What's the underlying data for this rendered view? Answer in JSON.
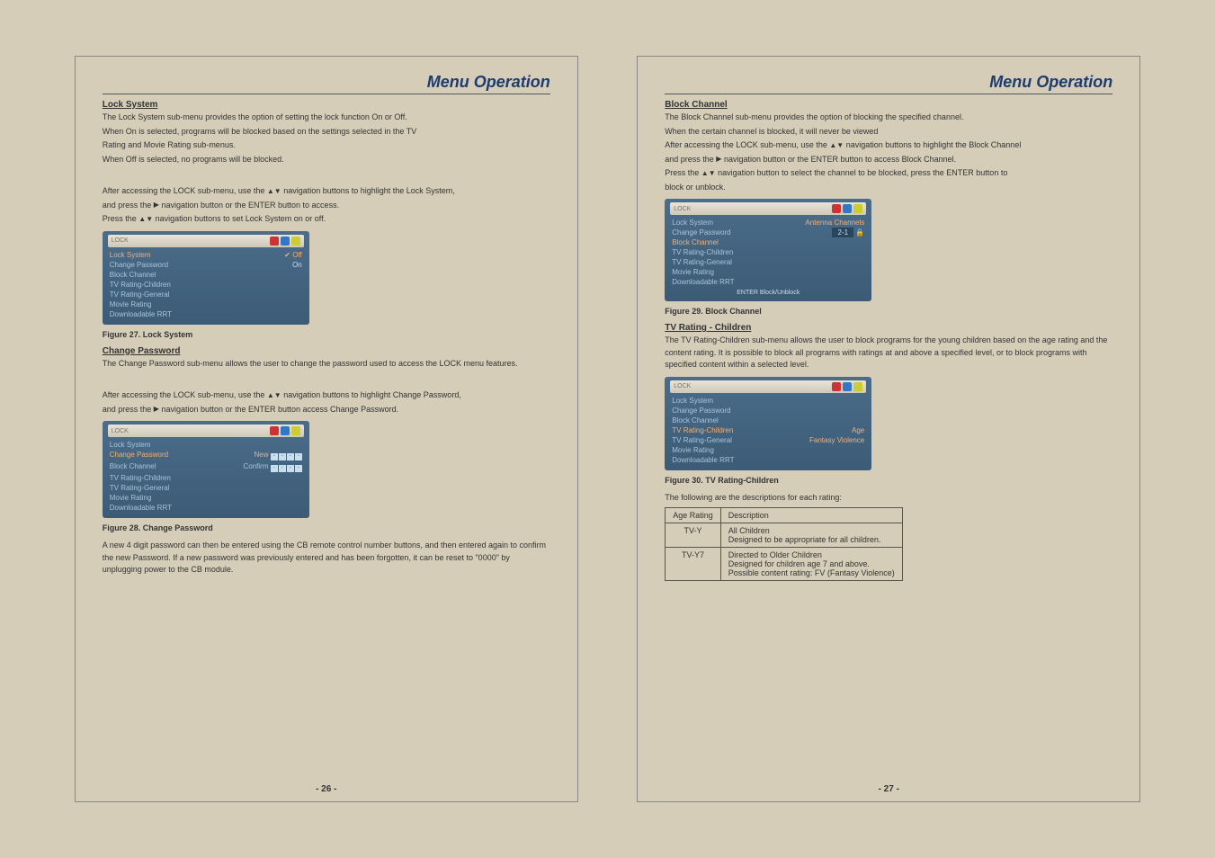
{
  "header": {
    "title": "Menu Operation"
  },
  "page_left": {
    "lock_system": {
      "title": "Lock System",
      "p1": "The Lock System sub-menu provides the option of setting the lock function On or Off.",
      "p2": "When On is selected, programs will be blocked based on the settings selected in the TV",
      "p3": "Rating and Movie Rating sub-menus.",
      "p4": "When Off is selected, no programs will be blocked.",
      "p5a": "After accessing the LOCK sub-menu, use the ",
      "p5b": "  navigation buttons to highlight the Lock System,",
      "p6a": "and press the  ",
      "p6b": "  navigation button or the ENTER button to access.",
      "p7a": "Press the ",
      "p7b": " navigation buttons to set Lock System on or off."
    },
    "fig27": "Figure 27. Lock System",
    "change_password": {
      "title": "Change Password",
      "p1": "The Change Password sub-menu allows the user to change the password used to access the LOCK menu features.",
      "p2a": "After accessing the LOCK sub-menu, use the ",
      "p2b": "    navigation buttons to highlight Change Password,",
      "p3a": "and press the  ",
      "p3b": "  navigation button or the ENTER  button access Change Password."
    },
    "fig28": "Figure 28. Change Password",
    "footnote": "A new 4 digit password can then be entered using the CB remote control number buttons, and then entered again to confirm the new Password. If a new password was previously entered and has been forgotten, it can be reset to \"0000\" by unplugging power to the CB module.",
    "page_num": "- 26 -",
    "osd1": {
      "header_left": "LOCK",
      "items": [
        {
          "label": "Lock System",
          "val": "✔ Off",
          "sel": true
        },
        {
          "label": "Change Password",
          "val": "On"
        },
        {
          "label": "Block Channel"
        },
        {
          "label": "TV Rating-Children"
        },
        {
          "label": "TV Rating-General"
        },
        {
          "label": "Movie Rating"
        },
        {
          "label": "Downloadable RRT"
        }
      ]
    },
    "osd2": {
      "header_left": "LOCK",
      "items": [
        {
          "label": "Lock System"
        },
        {
          "label": "Change Password",
          "sel": true,
          "fields": [
            {
              "k": "New"
            },
            {
              "k": "Confirm"
            }
          ]
        },
        {
          "label": "Block Channel"
        },
        {
          "label": "TV Rating-Children"
        },
        {
          "label": "TV Rating-General"
        },
        {
          "label": "Movie Rating"
        },
        {
          "label": "Downloadable RRT"
        }
      ]
    }
  },
  "page_right": {
    "block_channel": {
      "title": "Block Channel",
      "p1": "The Block Channel sub-menu provides the option of blocking the specified channel.",
      "p2": "When the certain channel is blocked, it will never be viewed",
      "p3a": "After accessing the LOCK sub-menu, use the ",
      "p3b": " navigation buttons to highlight the Block Channel",
      "p4a": "and press the    ",
      "p4b": "   navigation button or the ENTER button to access Block Channel.",
      "p5a": "Press the ",
      "p5b": "  navigation button to select the channel to be blocked, press the ENTER button to",
      "p6": "block or unblock."
    },
    "fig29": "Figure 29. Block Channel",
    "tv_rating_children": {
      "title": "TV Rating - Children",
      "p1": "The TV Rating-Children sub-menu allows the user to block programs for the young children based on the age rating and the content rating. It is possible to block all programs with ratings at and above a specified level, or to block programs with specified content within a selected level."
    },
    "fig30": "Figure 30. TV Rating-Children",
    "rating_intro": "The following are the descriptions for each rating:",
    "rating_table": {
      "headers": [
        "Age Rating",
        "Description"
      ],
      "rows": [
        {
          "age": "TV-Y",
          "desc": [
            "All Children",
            "Designed to be appropriate for all children."
          ]
        },
        {
          "age": "TV-Y7",
          "desc": [
            "Directed to Older Children",
            "Designed for children age 7 and above.",
            "Possible content rating: FV (Fantasy Violence)"
          ]
        }
      ]
    },
    "page_num": "- 27 -",
    "osd3": {
      "header_left": "LOCK",
      "right_header": "Antenna Channels",
      "items": [
        {
          "label": "Lock System"
        },
        {
          "label": "Change Password"
        },
        {
          "label": "Block Channel",
          "sel": true,
          "lock": "2-1"
        },
        {
          "label": "TV Rating-Children"
        },
        {
          "label": "TV Rating-General"
        },
        {
          "label": "Movie Rating"
        },
        {
          "label": "Downloadable RRT"
        }
      ],
      "footer": "ENTER  Block/Unblock"
    },
    "osd4": {
      "header_left": "LOCK",
      "items": [
        {
          "label": "Lock System"
        },
        {
          "label": "Change Password"
        },
        {
          "label": "Block Channel"
        },
        {
          "label": "TV Rating-Children",
          "sel": true,
          "right": [
            "Age",
            "Fantasy Violence"
          ]
        },
        {
          "label": "TV Rating-General"
        },
        {
          "label": "Movie Rating"
        },
        {
          "label": "Downloadable RRT"
        }
      ]
    }
  }
}
